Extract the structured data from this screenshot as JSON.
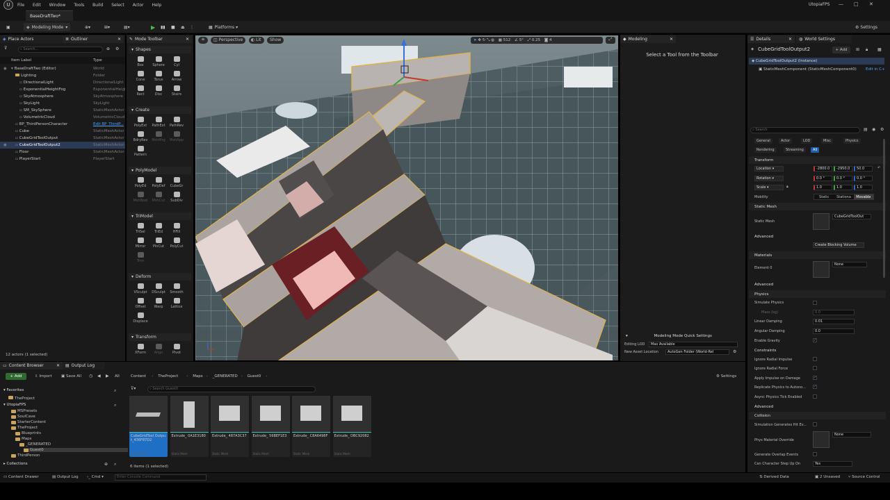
{
  "menu": {
    "logo": "U",
    "items": [
      "File",
      "Edit",
      "Window",
      "Tools",
      "Build",
      "Select",
      "Actor",
      "Help"
    ],
    "project_name": "UtopiaFPS"
  },
  "window_controls": {
    "minimize": "—",
    "maximize": "□",
    "close": "✕"
  },
  "doc_tab": {
    "label": "BaseDraftTwo*"
  },
  "toolbar": {
    "mode": "Modeling Mode",
    "platforms": "Platforms",
    "settings": "Settings"
  },
  "place_actors": {
    "tab1": "Place Actors",
    "tab2": "Outliner"
  },
  "outliner": {
    "search_placeholder": "Search...",
    "col_label": "Item Label",
    "col_type": "Type",
    "rows": [
      {
        "label": "BaseDraftTwo (Editor)",
        "type": "World",
        "indent": 0
      },
      {
        "label": "Lighting",
        "type": "Folder",
        "indent": 1
      },
      {
        "label": "DirectionalLight",
        "type": "DirectionalLight",
        "indent": 2
      },
      {
        "label": "ExponentialHeightFog",
        "type": "ExponentialHeightFog",
        "indent": 2
      },
      {
        "label": "SkyAtmosphere",
        "type": "SkyAtmosphere",
        "indent": 2
      },
      {
        "label": "SkyLight",
        "type": "SkyLight",
        "indent": 2
      },
      {
        "label": "SM_SkySphere",
        "type": "StaticMeshActor",
        "indent": 2
      },
      {
        "label": "VolumetricCloud",
        "type": "VolumetricCloud",
        "indent": 2
      },
      {
        "label": "BP_ThirdPersonCharacter",
        "type": "Edit BP_ThirdP...",
        "indent": 1
      },
      {
        "label": "Cube",
        "type": "StaticMeshActor",
        "indent": 1
      },
      {
        "label": "CubeGridToolOutput",
        "type": "StaticMeshActor",
        "indent": 1
      },
      {
        "label": "CubeGridToolOutput2",
        "type": "StaticMeshActor",
        "indent": 1
      },
      {
        "label": "Floor",
        "type": "StaticMeshActor",
        "indent": 1
      },
      {
        "label": "PlayerStart",
        "type": "PlayerStart",
        "indent": 1
      }
    ],
    "status": "12 actors (1 selected)"
  },
  "mode_toolbar": {
    "title": "Mode Toolbar",
    "sections": [
      {
        "name": "Shapes",
        "tools": [
          "Box",
          "Sphere",
          "Cyl",
          "Cone",
          "Torus",
          "Arrow",
          "Rect",
          "Disc",
          "Stairs"
        ]
      },
      {
        "name": "Create",
        "tools": [
          "PolyExt",
          "PathExt",
          "PathRev",
          "BdryRev",
          "MshMrg",
          "MshApp",
          "Pattern"
        ]
      },
      {
        "name": "PolyModel",
        "tools": [
          "PolyEd",
          "PolyDef",
          "CubeGr",
          "MshBool",
          "MshCut",
          "SubDiv"
        ]
      },
      {
        "name": "TriModel",
        "tools": [
          "TriSel",
          "TriEd",
          "HFill",
          "Mirror",
          "PlnCut",
          "PolyCut",
          "Trim"
        ]
      },
      {
        "name": "Deform",
        "tools": [
          "VSculpt",
          "DSculpt",
          "Smooth",
          "Offset",
          "Warp",
          "Lattice",
          "Displace"
        ]
      },
      {
        "name": "Transform",
        "tools": [
          "XForm",
          "Align",
          "Pivot"
        ]
      }
    ]
  },
  "viewport": {
    "perspective": "Perspective",
    "lit": "Lit",
    "show": "Show",
    "snap": "512",
    "angle": "5°",
    "scale": "0.25",
    "cam": "4"
  },
  "modeling_panel": {
    "title": "Modeling",
    "prompt": "Select a Tool from the Toolbar",
    "quick_settings": "Modeling Mode Quick Settings",
    "editing_lod_label": "Editing LOD",
    "editing_lod_value": "Max Available",
    "asset_loc_label": "New Asset Location",
    "asset_loc_value": "AutoGen Folder (World-Rel"
  },
  "details": {
    "tab1": "Details",
    "tab2": "World Settings",
    "actor_name": "CubeGridToolOutput2",
    "add": "+ Add",
    "instance": "CubeGridToolOutput2 (Instance)",
    "component": "StaticMeshComponent (StaticMeshComponent0)",
    "edit_cpp": "Edit in C++",
    "search_placeholder": "Search",
    "filters": [
      "General",
      "Actor",
      "LOD",
      "Misc",
      "Physics",
      "Rendering",
      "Streaming",
      "All"
    ],
    "transform": "Transform",
    "location_label": "Location",
    "location": [
      "-2800.0",
      "-2950.0",
      "50.0"
    ],
    "rotation_label": "Rotation",
    "rotation": [
      "0.0 °",
      "0.0 °",
      "0.0 °"
    ],
    "scale_label": "Scale",
    "scale": [
      "1.0",
      "1.0",
      "1.0"
    ],
    "mobility_label": "Mobility",
    "mobility": [
      "Static",
      "Stationa",
      "Movable"
    ],
    "static_mesh_section": "Static Mesh",
    "static_mesh_label": "Static Mesh",
    "static_mesh_value": "CubeGridToolOut",
    "advanced": "Advanced",
    "create_blocking": "Create Blocking Volume",
    "materials": "Materials",
    "element0": "Element 0",
    "element0_value": "None",
    "physics": "Physics",
    "simulate_physics": "Simulate Physics",
    "mass_kg": "Mass (kg)",
    "mass_value": "0.0",
    "linear_damping": "Linear Damping",
    "linear_damping_value": "0.01",
    "angular_damping": "Angular Damping",
    "angular_damping_value": "0.0",
    "enable_gravity": "Enable Gravity",
    "constraints": "Constraints",
    "ignore_radial_impulse": "Ignore Radial Impulse",
    "ignore_radial_force": "Ignore Radial Force",
    "apply_impulse": "Apply Impulse on Damage",
    "replicate_physics": "Replicate Physics to Autono...",
    "async_physics": "Async Physics Tick Enabled",
    "collision": "Collision",
    "sim_hit": "Simulation Generates Hit Ev...",
    "phys_material": "Phys Material Override",
    "phys_material_value": "None",
    "gen_overlap": "Generate Overlap Events",
    "char_step": "Can Character Step Up On",
    "char_step_value": "Yes"
  },
  "content_browser": {
    "tab1": "Content Browser",
    "tab2": "Output Log",
    "add": "+ Add",
    "import": "Import",
    "save_all": "Save All",
    "all": "All",
    "crumbs": [
      "Content",
      "TheProject",
      "Maps",
      "_GENERATED",
      "Guest0"
    ],
    "settings": "Settings",
    "search_placeholder": "Search Guest0",
    "favorites": "Favorites",
    "fav_item": "TheProject",
    "project": "UtopiaFPS",
    "tree": [
      "MSPresets",
      "SoulCave",
      "StarterContent",
      "TheProject",
      "Blueprints",
      "Maps",
      "_GENERATED",
      "Guest0",
      "ThirdPerson"
    ],
    "collections": "Collections",
    "status": "6 items (1 selected)",
    "assets": [
      {
        "name": "CubeGridTool Output_436F87D2",
        "type": "Static Mesh"
      },
      {
        "name": "Extrude_ 0A1E3180",
        "type": "Static Mesh"
      },
      {
        "name": "Extrude_ 487A3C37",
        "type": "Static Mesh"
      },
      {
        "name": "Extrude_ 56BEF1E3",
        "type": "Static Mesh"
      },
      {
        "name": "Extrude_ C8A6498F",
        "type": "Static Mesh"
      },
      {
        "name": "Extrude_ DBC92082",
        "type": "Static Mesh"
      }
    ]
  },
  "statusbar": {
    "content_drawer": "Content Drawer",
    "output_log": "Output Log",
    "cmd": "Cmd",
    "console_placeholder": "Enter Console Command",
    "derived_data": "Derived Data",
    "unsaved": "2 Unsaved",
    "source_control": "Source Control"
  }
}
